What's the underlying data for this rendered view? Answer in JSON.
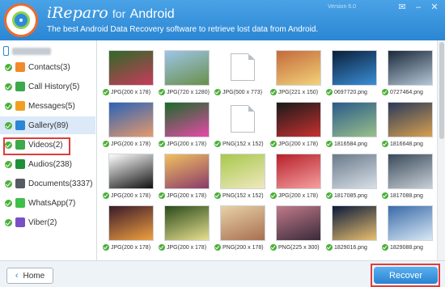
{
  "header": {
    "brand": "iReparo",
    "for_text": "for",
    "platform": "Android",
    "subtitle": "The best Android Data Recovery software to retrieve lost data from Android.",
    "version": "Version 6.0",
    "window_buttons": [
      "✉",
      "–",
      "✕"
    ]
  },
  "sidebar": {
    "categories": [
      {
        "label": "Contacts(3)",
        "icon_color": "#f08a2c",
        "icon": "contacts-icon"
      },
      {
        "label": "Call History(5)",
        "icon_color": "#3aaa4a",
        "icon": "phone-icon"
      },
      {
        "label": "Messages(5)",
        "icon_color": "#f0a020",
        "icon": "message-icon"
      },
      {
        "label": "Gallery(89)",
        "icon_color": "#2b86d4",
        "icon": "gallery-icon"
      },
      {
        "label": "Videos(2)",
        "icon_color": "#3aaa4a",
        "icon": "video-icon"
      },
      {
        "label": "Audios(238)",
        "icon_color": "#1f8f3a",
        "icon": "audio-icon"
      },
      {
        "label": "Documents(3337)",
        "icon_color": "#555b62",
        "icon": "document-icon"
      },
      {
        "label": "WhatsApp(7)",
        "icon_color": "#3fbf4a",
        "icon": "whatsapp-icon"
      },
      {
        "label": "Viber(2)",
        "icon_color": "#7b4fc4",
        "icon": "viber-icon"
      }
    ],
    "selected_index": 3
  },
  "gallery": {
    "items": [
      {
        "caption": "JPG(200 x 178)",
        "colors": [
          "#2f6a28",
          "#c93a5a"
        ]
      },
      {
        "caption": "JPG(720 x 1280)",
        "colors": [
          "#9cc5e8",
          "#6a8f4a"
        ]
      },
      {
        "caption": "JPG(500 x 773)",
        "colors": [
          "#6b3a28",
          "#d04a3a"
        ]
      },
      {
        "caption": "JPG(221 x 150)",
        "colors": [
          "#c46a3a",
          "#f2d27a"
        ]
      },
      {
        "caption": "0697720.png",
        "colors": [
          "#0b1f3a",
          "#3a8fd8"
        ]
      },
      {
        "caption": "0727464.png",
        "colors": [
          "#1a2a3a",
          "#b5c6d8"
        ]
      },
      {
        "caption": "JPG(200 x 178)",
        "colors": [
          "#2a62b8",
          "#e89a6a"
        ]
      },
      {
        "caption": "JPG(200 x 178)",
        "colors": [
          "#1a6a2a",
          "#e84aa8"
        ]
      },
      {
        "caption": "PNG(152 x 152)",
        "colors": [
          "#5a1a1a",
          "#a8342a"
        ]
      },
      {
        "caption": "JPG(200 x 178)",
        "colors": [
          "#1a1a1a",
          "#c83030"
        ]
      },
      {
        "caption": "1816584.png",
        "colors": [
          "#2a5a8a",
          "#9ac08a"
        ]
      },
      {
        "caption": "1816648.png",
        "colors": [
          "#2a3a5a",
          "#d8a050"
        ]
      },
      {
        "caption": "JPG(200 x 178)",
        "colors": [
          "#ffffff",
          "#111111"
        ]
      },
      {
        "caption": "JPG(200 x 178)",
        "colors": [
          "#f0c060",
          "#8a3a6a"
        ]
      },
      {
        "caption": "PNG(152 x 152)",
        "colors": [
          "#a8c84a",
          "#f0e8c0"
        ]
      },
      {
        "caption": "JPG(200 x 178)",
        "colors": [
          "#b8202a",
          "#f4a0a0"
        ]
      },
      {
        "caption": "1817085.png",
        "colors": [
          "#6a7a8a",
          "#d8e0e8"
        ]
      },
      {
        "caption": "1817088.png",
        "colors": [
          "#3a4a5a",
          "#c8d0d8"
        ]
      },
      {
        "caption": "JPG(200 x 178)",
        "colors": [
          "#3a1a2a",
          "#f0a040"
        ]
      },
      {
        "caption": "JPG(200 x 178)",
        "colors": [
          "#2a4a1a",
          "#e8e090"
        ]
      },
      {
        "caption": "PNG(200 x 178)",
        "colors": [
          "#e8d0a8",
          "#a87050"
        ]
      },
      {
        "caption": "PNG(225 x 300)",
        "colors": [
          "#c07a8a",
          "#3a2a3a"
        ]
      },
      {
        "caption": "1829016.png",
        "colors": [
          "#0a1a3a",
          "#e8c070"
        ]
      },
      {
        "caption": "1829088.png",
        "colors": [
          "#3a6aa8",
          "#d8e8f4"
        ]
      }
    ],
    "blank_indices": [
      2,
      8
    ]
  },
  "footer": {
    "home_label": "Home",
    "recover_label": "Recover"
  }
}
